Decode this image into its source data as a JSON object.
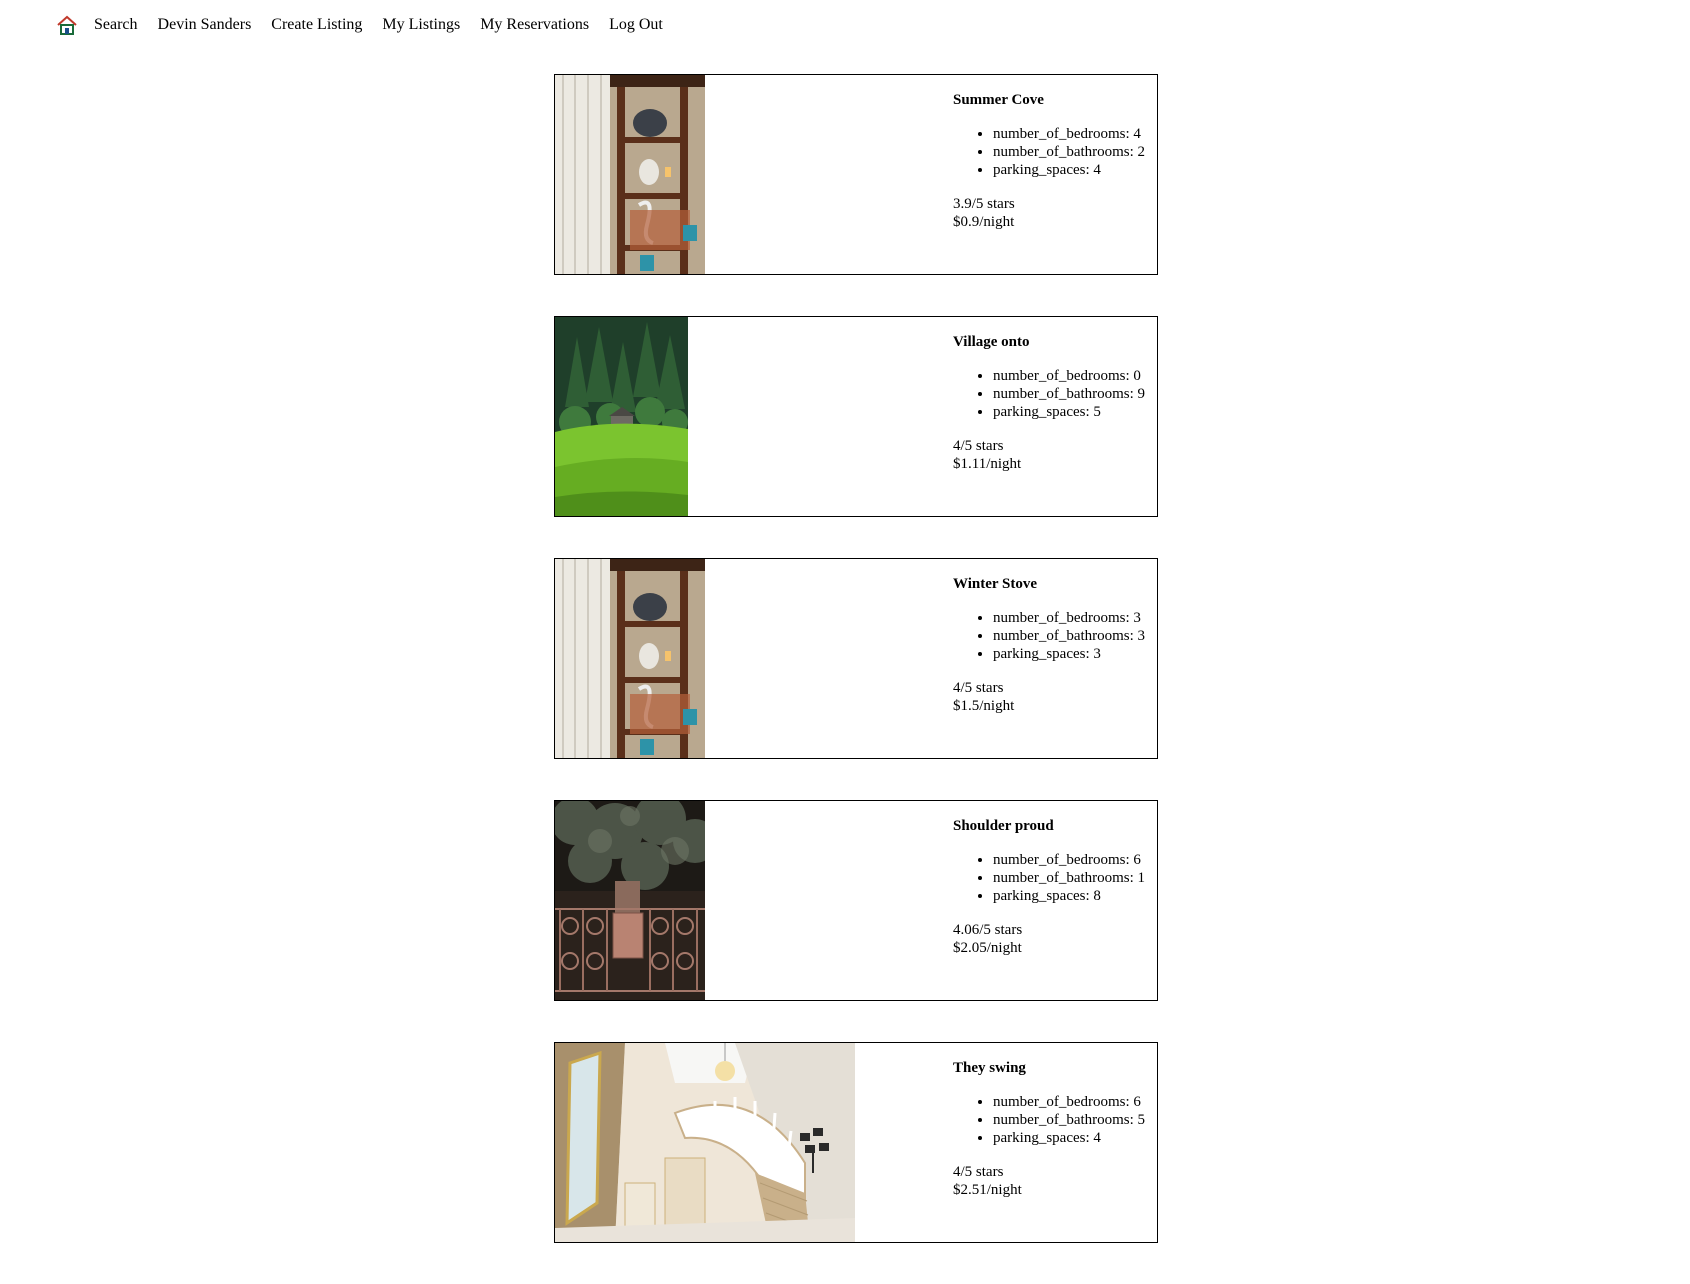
{
  "nav": {
    "home_icon": "house-icon",
    "links": [
      "Search",
      "Devin Sanders",
      "Create Listing",
      "My Listings",
      "My Reservations",
      "Log Out"
    ]
  },
  "listings": [
    {
      "title": "Summer Cove",
      "bedrooms": "number_of_bedrooms: 4",
      "bathrooms": "number_of_bathrooms: 2",
      "parking": "parking_spaces: 4",
      "rating": "3.9/5 stars",
      "price": "$0.9/night",
      "photo": "shelves-interior"
    },
    {
      "title": "Village onto",
      "bedrooms": "number_of_bedrooms: 0",
      "bathrooms": "number_of_bathrooms: 9",
      "parking": "parking_spaces: 5",
      "rating": "4/5 stars",
      "price": "$1.11/night",
      "photo": "forest-hillside"
    },
    {
      "title": "Winter Stove",
      "bedrooms": "number_of_bedrooms: 3",
      "bathrooms": "number_of_bathrooms: 3",
      "parking": "parking_spaces: 3",
      "rating": "4/5 stars",
      "price": "$1.5/night",
      "photo": "shelves-interior"
    },
    {
      "title": "Shoulder proud",
      "bedrooms": "number_of_bedrooms: 6",
      "bathrooms": "number_of_bathrooms: 1",
      "parking": "parking_spaces: 8",
      "rating": "4.06/5 stars",
      "price": "$2.05/night",
      "photo": "iron-gate"
    },
    {
      "title": "They swing",
      "bedrooms": "number_of_bedrooms: 6",
      "bathrooms": "number_of_bathrooms: 5",
      "parking": "parking_spaces: 4",
      "rating": "4/5 stars",
      "price": "$2.51/night",
      "photo": "staircase-foyer"
    }
  ]
}
